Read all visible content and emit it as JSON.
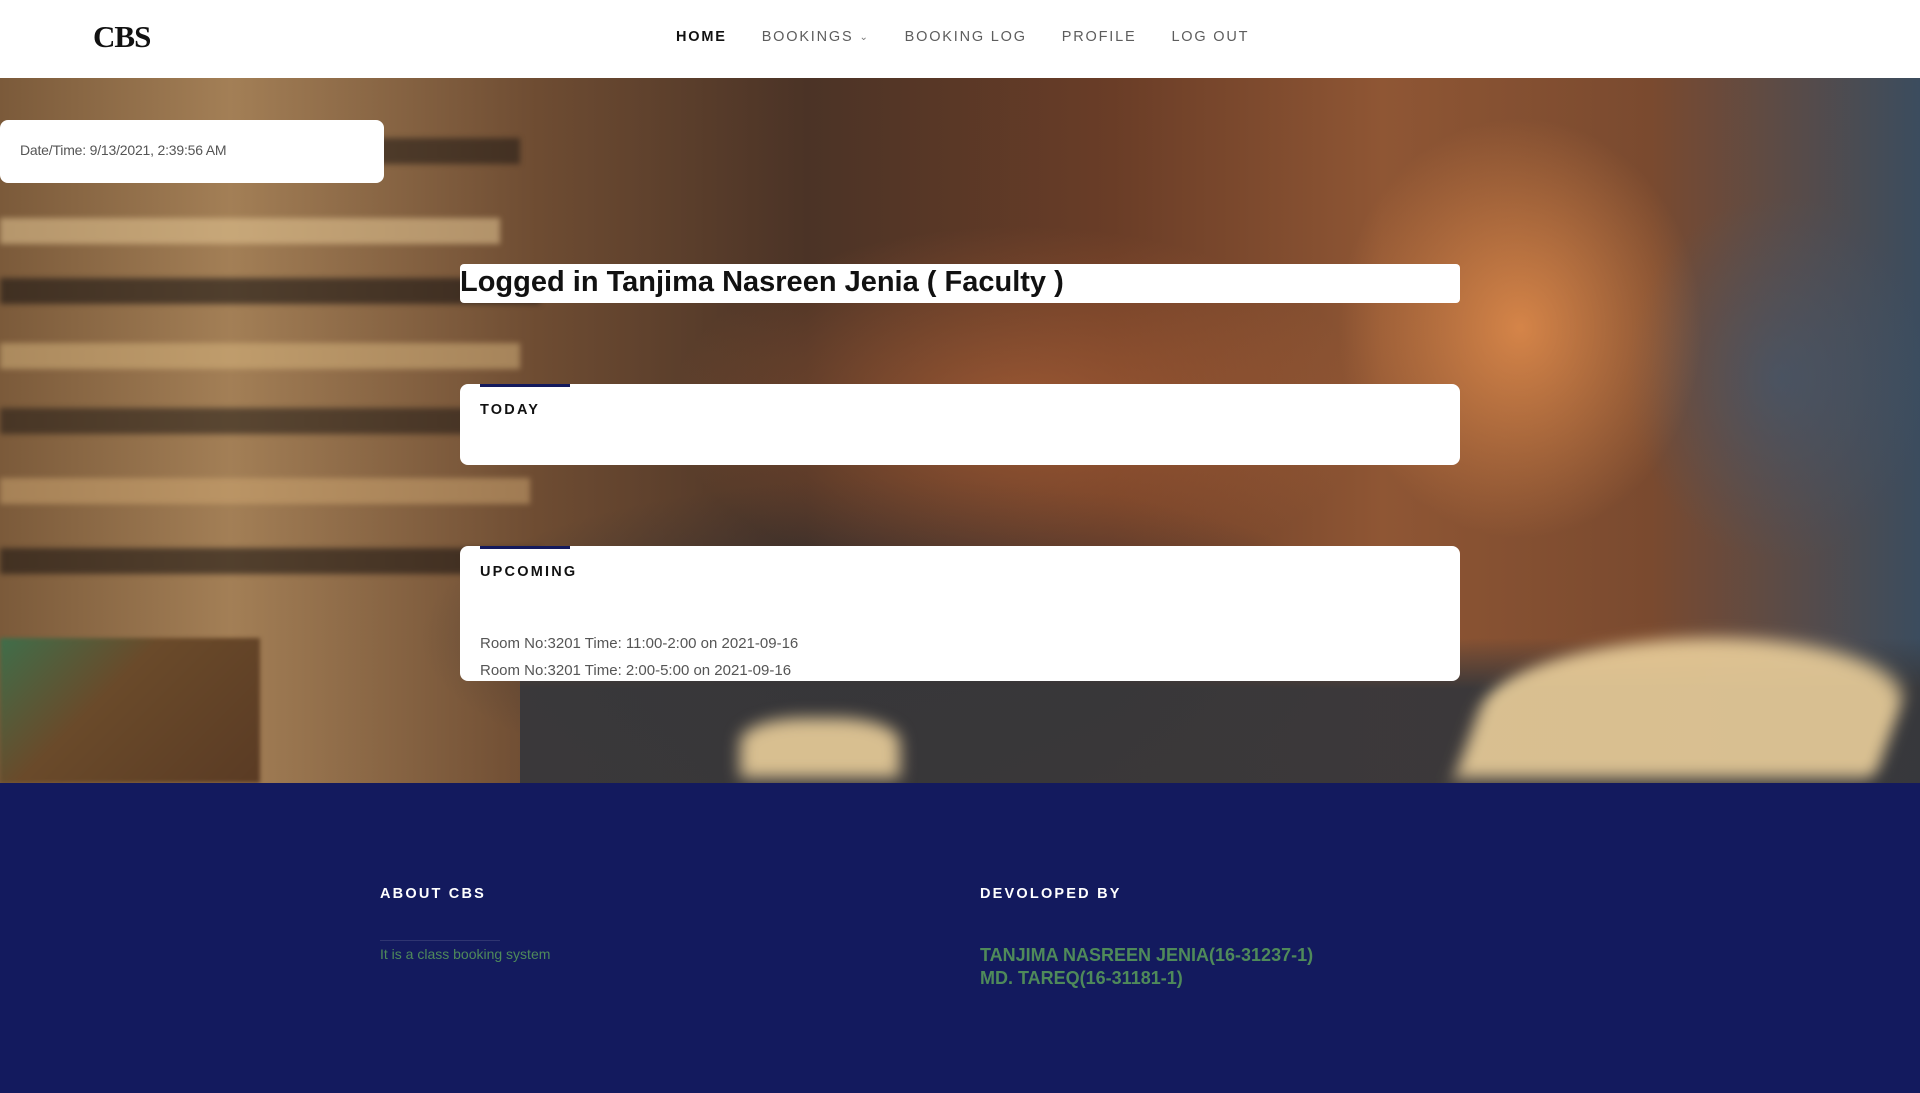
{
  "header": {
    "logo": "CBS",
    "nav": [
      {
        "label": "HOME",
        "active": true
      },
      {
        "label": "BOOKINGS",
        "has_dropdown": true
      },
      {
        "label": "BOOKING LOG"
      },
      {
        "label": "PROFILE"
      },
      {
        "label": "LOG OUT"
      }
    ]
  },
  "datetime": {
    "text": "Date/Time: 9/13/2021, 2:39:56 AM"
  },
  "welcome": {
    "text": "Logged in Tanjima Nasreen Jenia ( Faculty )"
  },
  "today": {
    "title": "TODAY",
    "items": []
  },
  "upcoming": {
    "title": "UPCOMING",
    "items": [
      "Room No:3201 Time: 11:00-2:00 on 2021-09-16",
      "Room No:3201 Time: 2:00-5:00 on 2021-09-16"
    ]
  },
  "footer": {
    "about_title": "ABOUT CBS",
    "about_text": "It is a class booking system",
    "developed_title": "DEVOLOPED BY",
    "developers": [
      "TANJIMA NASREEN JENIA(16-31237-1)",
      "MD. TAREQ(16-31181-1)"
    ]
  },
  "colors": {
    "footer_bg": "#131a5e",
    "footer_link": "#4f8a5a",
    "accent": "#131a5e"
  }
}
